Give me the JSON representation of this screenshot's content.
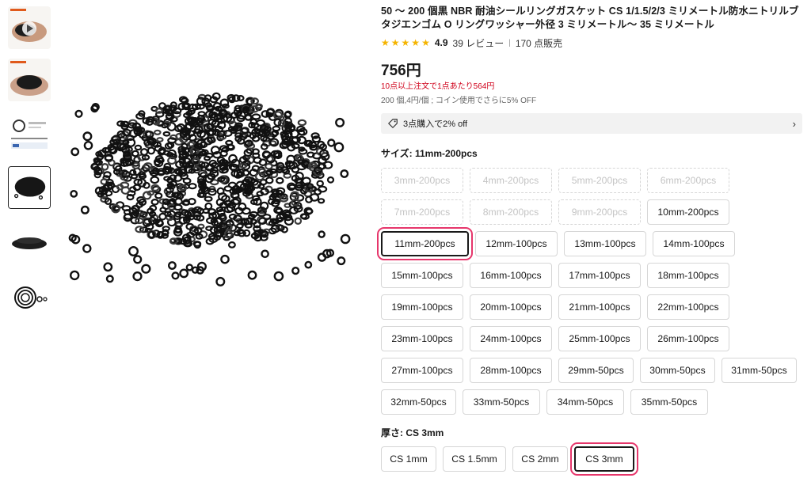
{
  "product": {
    "title": "50 〜 200 個黒 NBR 耐油シールリングガスケット CS 1/1.5/2/3 ミリメートル防水ニトリルブタジエンゴム O リングワッシャー外径 3 ミリメートル〜 35 ミリメートル",
    "rating": "4.9",
    "reviews": "39 レビュー",
    "sold": "170 点販売",
    "price": "756円",
    "bulk_note": "10点以上注文で1点あたり564円",
    "unit_note": "200 個,4円/個 ; コイン使用でさらに5% OFF",
    "promo": "3点購入で2% off"
  },
  "size": {
    "label": "サイズ: 11mm-200pcs",
    "options": [
      {
        "label": "3mm-200pcs",
        "state": "disabled"
      },
      {
        "label": "4mm-200pcs",
        "state": "disabled"
      },
      {
        "label": "5mm-200pcs",
        "state": "disabled"
      },
      {
        "label": "6mm-200pcs",
        "state": "disabled"
      },
      {
        "label": "7mm-200pcs",
        "state": "disabled"
      },
      {
        "label": "8mm-200pcs",
        "state": "disabled"
      },
      {
        "label": "9mm-200pcs",
        "state": "disabled"
      },
      {
        "label": "10mm-200pcs",
        "state": "normal"
      },
      {
        "label": "11mm-200pcs",
        "state": "selected"
      },
      {
        "label": "12mm-100pcs",
        "state": "normal"
      },
      {
        "label": "13mm-100pcs",
        "state": "normal"
      },
      {
        "label": "14mm-100pcs",
        "state": "normal"
      },
      {
        "label": "15mm-100pcs",
        "state": "normal"
      },
      {
        "label": "16mm-100pcs",
        "state": "normal"
      },
      {
        "label": "17mm-100pcs",
        "state": "normal"
      },
      {
        "label": "18mm-100pcs",
        "state": "normal"
      },
      {
        "label": "19mm-100pcs",
        "state": "normal"
      },
      {
        "label": "20mm-100pcs",
        "state": "normal"
      },
      {
        "label": "21mm-100pcs",
        "state": "normal"
      },
      {
        "label": "22mm-100pcs",
        "state": "normal"
      },
      {
        "label": "23mm-100pcs",
        "state": "normal"
      },
      {
        "label": "24mm-100pcs",
        "state": "normal"
      },
      {
        "label": "25mm-100pcs",
        "state": "normal"
      },
      {
        "label": "26mm-100pcs",
        "state": "normal"
      },
      {
        "label": "27mm-100pcs",
        "state": "normal"
      },
      {
        "label": "28mm-100pcs",
        "state": "normal"
      },
      {
        "label": "29mm-50pcs",
        "state": "normal"
      },
      {
        "label": "30mm-50pcs",
        "state": "normal"
      },
      {
        "label": "31mm-50pcs",
        "state": "normal"
      },
      {
        "label": "32mm-50pcs",
        "state": "normal"
      },
      {
        "label": "33mm-50pcs",
        "state": "normal"
      },
      {
        "label": "34mm-50pcs",
        "state": "normal"
      },
      {
        "label": "35mm-50pcs",
        "state": "normal"
      }
    ]
  },
  "thickness": {
    "label": "厚さ: CS 3mm",
    "options": [
      {
        "label": "CS 1mm",
        "state": "normal"
      },
      {
        "label": "CS 1.5mm",
        "state": "normal"
      },
      {
        "label": "CS 2mm",
        "state": "normal"
      },
      {
        "label": "CS 3mm",
        "state": "selected"
      }
    ]
  },
  "icons": {
    "star": "star-icon",
    "tag": "tag-icon",
    "chevron": "chevron-right-icon",
    "play": "play-icon"
  },
  "colors": {
    "star": "#f5b400",
    "bulk_note": "#d0021b",
    "selected_highlight": "#e6366b",
    "selected_border": "#191919"
  }
}
